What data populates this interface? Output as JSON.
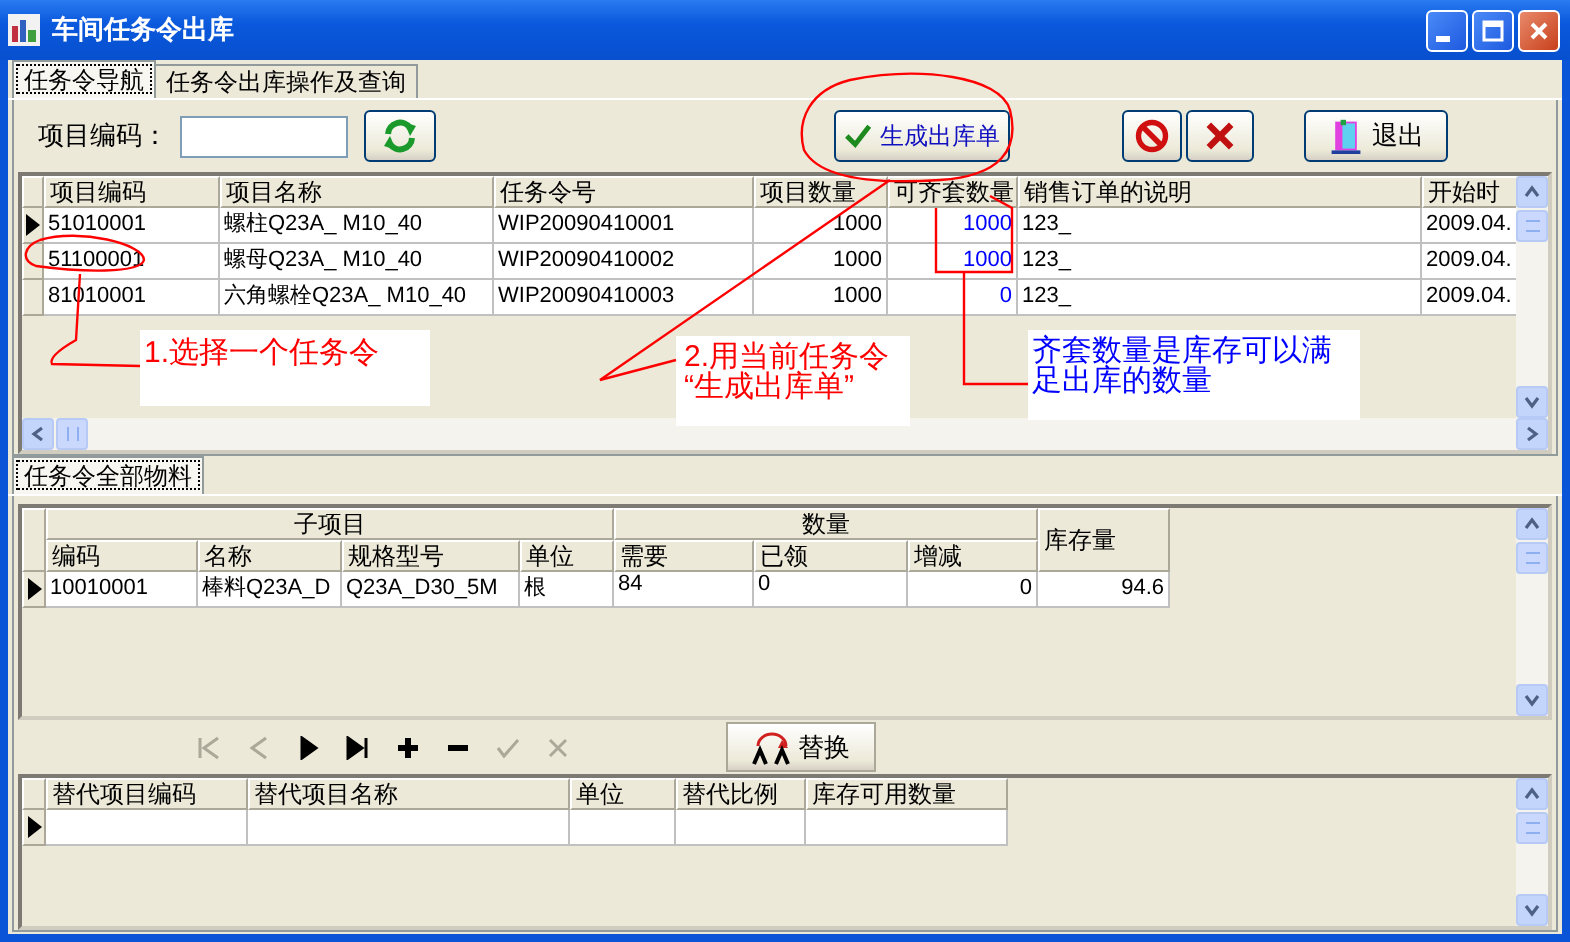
{
  "window": {
    "title": "车间任务令出库"
  },
  "tabs": [
    {
      "label": "任务令导航",
      "selected": true
    },
    {
      "label": "任务令出库操作及查询",
      "selected": false
    }
  ],
  "filter": {
    "label": "项目编码："
  },
  "actions": [
    {
      "kind": "refresh"
    },
    {
      "kind": "generate",
      "label": "生成出库单"
    },
    {
      "kind": "cancel"
    },
    {
      "kind": "delete"
    },
    {
      "kind": "exit",
      "label": "退出"
    }
  ],
  "task_grid": {
    "columns": [
      {
        "label": "项目编码",
        "kind": "text"
      },
      {
        "label": "项目名称",
        "kind": "text"
      },
      {
        "label": "任务令号",
        "kind": "text"
      },
      {
        "label": "项目数量",
        "kind": "number"
      },
      {
        "label": "可齐套数量",
        "kind": "count"
      },
      {
        "label": "销售订单的说明",
        "kind": "text"
      },
      {
        "label": "开始时",
        "kind": "text"
      }
    ],
    "rows": [
      {
        "current": true,
        "cells": [
          "51010001",
          "螺柱Q23A_ M10_40",
          "WIP20090410001",
          "1000",
          "1000",
          "123_",
          "2009.04."
        ]
      },
      {
        "current": false,
        "cells": [
          "51100001",
          "螺母Q23A_ M10_40",
          "WIP20090410002",
          "1000",
          "1000",
          "123_",
          "2009.04."
        ]
      },
      {
        "current": false,
        "cells": [
          "81010001",
          "六角螺栓Q23A_ M10_40",
          "WIP20090410003",
          "1000",
          "0",
          "123_",
          "2009.04."
        ]
      }
    ]
  },
  "annotations": [
    {
      "lines": [
        "1.选择一个任务令"
      ],
      "color": "#ff0000"
    },
    {
      "lines": [
        "2.用当前任务令",
        "“生成出库单”"
      ],
      "color": "#ff0000"
    },
    {
      "lines": [
        "齐套数量是库存可以满足出库的数量"
      ],
      "color": "#0000ff"
    }
  ],
  "material_tabs": [
    {
      "label": "任务令全部物料",
      "selected": true
    }
  ],
  "material_grid": {
    "groups": [
      {
        "label": "子项目",
        "columns": [
          {
            "label": "编码",
            "kind": "text"
          },
          {
            "label": "名称",
            "kind": "text"
          },
          {
            "label": "规格型号",
            "kind": "text"
          },
          {
            "label": "单位",
            "kind": "text"
          }
        ]
      },
      {
        "label": "数量",
        "columns": [
          {
            "label": "需要",
            "kind": "raw"
          },
          {
            "label": "已领",
            "kind": "raw"
          },
          {
            "label": "增减",
            "kind": "number"
          }
        ]
      },
      {
        "columns": [
          {
            "label": "库存量",
            "kind": "number"
          }
        ]
      }
    ],
    "rows": [
      {
        "current": true,
        "cells": [
          "10010001",
          "棒料Q23A_D",
          "Q23A_D30_5M",
          "根",
          "84",
          "0",
          "0",
          "94.6"
        ]
      }
    ]
  },
  "navigator": {
    "buttons": [
      {
        "kind": "first",
        "disabled": true
      },
      {
        "kind": "prior",
        "disabled": true
      },
      {
        "kind": "next",
        "disabled": false
      },
      {
        "kind": "last",
        "disabled": false
      },
      {
        "kind": "insert",
        "disabled": false
      },
      {
        "kind": "remove",
        "disabled": false
      },
      {
        "kind": "post",
        "disabled": true
      },
      {
        "kind": "cancel",
        "disabled": true
      }
    ],
    "replace_button": {
      "label": "替换"
    }
  },
  "substitute_grid": {
    "columns": [
      {
        "label": "替代项目编码"
      },
      {
        "label": "替代项目名称"
      },
      {
        "label": "单位"
      },
      {
        "label": "替代比例"
      },
      {
        "label": "库存可用数量"
      }
    ],
    "rows": [
      {
        "current": true
      }
    ]
  }
}
